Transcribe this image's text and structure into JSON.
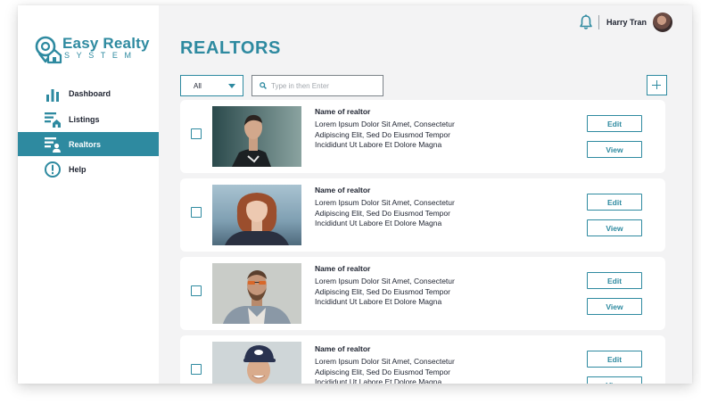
{
  "app": {
    "name": "Easy Realty",
    "subtitle": "SYSTEM",
    "accent_color": "#2e8aa0"
  },
  "sidebar": {
    "items": [
      {
        "label": "Dashboard",
        "icon": "bar-chart-icon",
        "active": false
      },
      {
        "label": "Listings",
        "icon": "listings-icon",
        "active": false
      },
      {
        "label": "Realtors",
        "icon": "realtors-icon",
        "active": true
      },
      {
        "label": "Help",
        "icon": "exclamation-circle-icon",
        "active": false
      }
    ]
  },
  "header": {
    "user_name": "Harry Tran",
    "notification_icon": "bell-icon"
  },
  "page": {
    "title": "REALTORS"
  },
  "controls": {
    "filter_value": "All",
    "search_placeholder": "Type in then Enter"
  },
  "realtors": [
    {
      "name": "Name of realtor",
      "description": "Lorem Ipsum Dolor Sit Amet, Consectetur Adipiscing Elit, Sed Do Eiusmod Tempor Incididunt Ut Labore Et Dolore Magna",
      "edit_label": "Edit",
      "view_label": "View"
    },
    {
      "name": "Name of realtor",
      "description": "Lorem Ipsum Dolor Sit Amet, Consectetur Adipiscing Elit, Sed Do Eiusmod Tempor Incididunt Ut Labore Et Dolore Magna",
      "edit_label": "Edit",
      "view_label": "View"
    },
    {
      "name": "Name of realtor",
      "description": "Lorem Ipsum Dolor Sit Amet, Consectetur Adipiscing Elit, Sed Do Eiusmod Tempor Incididunt Ut Labore Et Dolore Magna",
      "edit_label": "Edit",
      "view_label": "View"
    },
    {
      "name": "Name of realtor",
      "description": "Lorem Ipsum Dolor Sit Amet, Consectetur Adipiscing Elit, Sed Do Eiusmod Tempor Incididunt Ut Labore Et Dolore Magna",
      "edit_label": "Edit",
      "view_label": "View"
    }
  ]
}
